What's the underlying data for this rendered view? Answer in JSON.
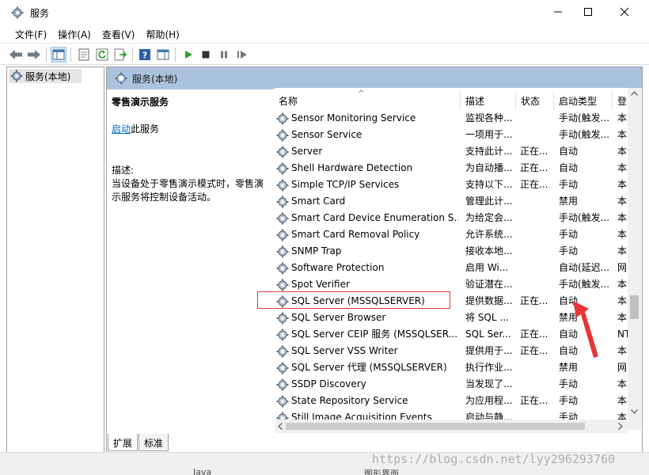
{
  "window": {
    "title": "服务",
    "minimize_icon": "minimize-icon",
    "maximize_icon": "maximize-icon",
    "close_icon": "close-icon"
  },
  "menu": [
    "文件(F)",
    "操作(A)",
    "查看(V)",
    "帮助(H)"
  ],
  "tree": {
    "root_label": "服务(本地)"
  },
  "content": {
    "header_label": "服务(本地)",
    "selected_service": "零售演示服务",
    "start_link": "启动",
    "start_suffix": "此服务",
    "desc_label": "描述:",
    "desc_text": "当设备处于零售演示模式时，零售演示服务将控制设备活动。"
  },
  "columns": {
    "name": "名称",
    "description": "描述",
    "status": "状态",
    "startup_type": "启动类型",
    "logon": "登"
  },
  "services": [
    {
      "name": "Sensor Monitoring Service",
      "desc": "监视各种...",
      "status": "",
      "startup": "手动(触发...",
      "logon": "本"
    },
    {
      "name": "Sensor Service",
      "desc": "一项用于...",
      "status": "",
      "startup": "手动(触发...",
      "logon": "本"
    },
    {
      "name": "Server",
      "desc": "支持此计...",
      "status": "正在...",
      "startup": "自动",
      "logon": "本"
    },
    {
      "name": "Shell Hardware Detection",
      "desc": "为自动播...",
      "status": "正在...",
      "startup": "自动",
      "logon": "本"
    },
    {
      "name": "Simple TCP/IP Services",
      "desc": "支持以下...",
      "status": "正在...",
      "startup": "手动",
      "logon": "本"
    },
    {
      "name": "Smart Card",
      "desc": "管理此计...",
      "status": "",
      "startup": "禁用",
      "logon": "本"
    },
    {
      "name": "Smart Card Device Enumeration S...",
      "desc": "为给定会...",
      "status": "",
      "startup": "手动(触发...",
      "logon": "本"
    },
    {
      "name": "Smart Card Removal Policy",
      "desc": "允许系统...",
      "status": "",
      "startup": "手动",
      "logon": "本"
    },
    {
      "name": "SNMP Trap",
      "desc": "接收本地...",
      "status": "",
      "startup": "手动",
      "logon": "本"
    },
    {
      "name": "Software Protection",
      "desc": "启用 Wi...",
      "status": "",
      "startup": "自动(延迟...",
      "logon": "网"
    },
    {
      "name": "Spot Verifier",
      "desc": "验证潜在...",
      "status": "",
      "startup": "手动(触发...",
      "logon": "本"
    },
    {
      "name": "SQL Server (MSSQLSERVER)",
      "desc": "提供数据...",
      "status": "正在...",
      "startup": "自动",
      "logon": "本"
    },
    {
      "name": "SQL Server Browser",
      "desc": "将 SQL ...",
      "status": "",
      "startup": "禁用",
      "logon": "本"
    },
    {
      "name": "SQL Server CEIP 服务 (MSSQLSER...",
      "desc": "SQL Ser...",
      "status": "正在...",
      "startup": "自动",
      "logon": "NT"
    },
    {
      "name": "SQL Server VSS Writer",
      "desc": "提供用于...",
      "status": "正在...",
      "startup": "自动",
      "logon": "本"
    },
    {
      "name": "SQL Server 代理 (MSSQLSERVER)",
      "desc": "执行作业...",
      "status": "",
      "startup": "禁用",
      "logon": "网"
    },
    {
      "name": "SSDP Discovery",
      "desc": "当发现了...",
      "status": "",
      "startup": "手动",
      "logon": "本"
    },
    {
      "name": "State Repository Service",
      "desc": "为应用程...",
      "status": "正在...",
      "startup": "手动",
      "logon": "本"
    },
    {
      "name": "Still Image Acquisition Events",
      "desc": "启动与静...",
      "status": "",
      "startup": "手动",
      "logon": "本"
    }
  ],
  "tabs": [
    "扩展",
    "标准"
  ],
  "bottom_strip": {
    "left_text": "Java",
    "right_text": "图形界面"
  },
  "watermark": "https://blog.csdn.net/lyy296293760",
  "colors": {
    "header_bg": "#aac2dc",
    "highlight": "#e53a3a",
    "link": "#0066cc"
  }
}
